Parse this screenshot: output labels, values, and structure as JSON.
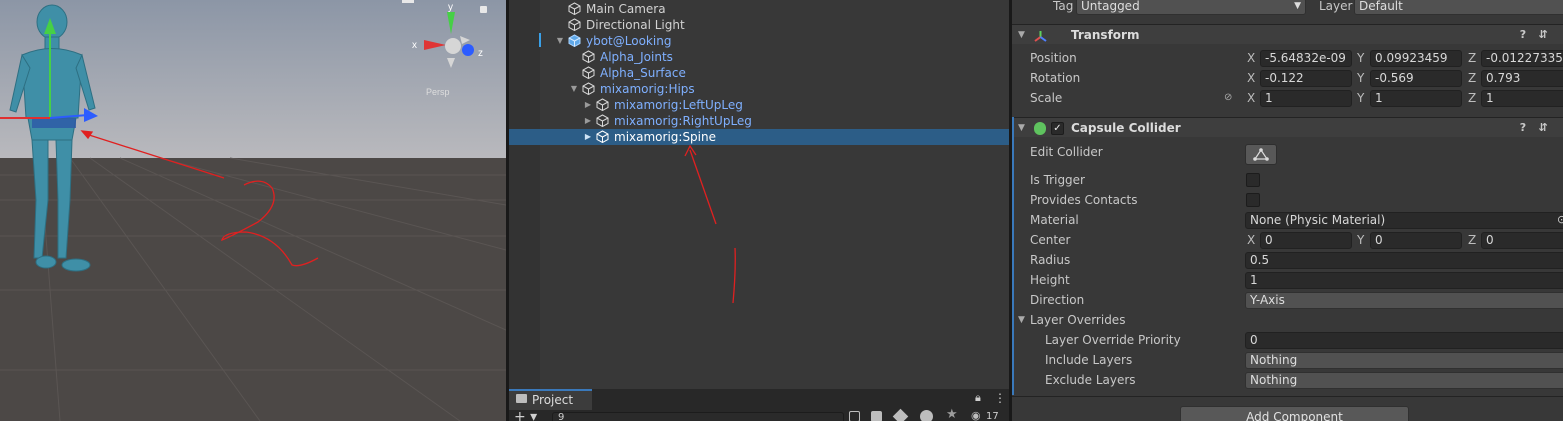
{
  "hierarchy": {
    "items": [
      {
        "label": "Main Camera",
        "style": "plain"
      },
      {
        "label": "Directional Light",
        "style": "plain"
      },
      {
        "label": "ybot@Looking",
        "style": "prefab"
      },
      {
        "label": "Alpha_Joints",
        "style": "prefab"
      },
      {
        "label": "Alpha_Surface",
        "style": "prefab"
      },
      {
        "label": "mixamorig:Hips",
        "style": "prefab"
      },
      {
        "label": "mixamorig:LeftUpLeg",
        "style": "prefab"
      },
      {
        "label": "mixamorig:RightUpLeg",
        "style": "prefab"
      },
      {
        "label": "mixamorig:Spine",
        "style": "selected"
      }
    ]
  },
  "project_panel": {
    "tab_label": "Project",
    "search_value": "9",
    "hidden_count": "17"
  },
  "scene": {
    "gizmo_axes": {
      "y": "y",
      "x": "x",
      "z": "z"
    },
    "persp_label": "Persp"
  },
  "inspector": {
    "tag_label": "Tag",
    "tag_value": "Untagged",
    "layer_label": "Layer",
    "layer_value": "Default",
    "transform": {
      "title": "Transform",
      "position_label": "Position",
      "rotation_label": "Rotation",
      "scale_label": "Scale",
      "position": {
        "x": "-5.64832e-09",
        "y": "0.09923459",
        "z": "-0.01227335"
      },
      "rotation": {
        "x": "-0.122",
        "y": "-0.569",
        "z": "0.793"
      },
      "scale": {
        "x": "1",
        "y": "1",
        "z": "1"
      }
    },
    "capsule": {
      "title": "Capsule Collider",
      "edit_collider_label": "Edit Collider",
      "is_trigger_label": "Is Trigger",
      "provides_contacts_label": "Provides Contacts",
      "material_label": "Material",
      "material_value": "None (Physic Material)",
      "center_label": "Center",
      "center": {
        "x": "0",
        "y": "0",
        "z": "0"
      },
      "radius_label": "Radius",
      "radius_value": "0.5",
      "height_label": "Height",
      "height_value": "1",
      "direction_label": "Direction",
      "direction_value": "Y-Axis",
      "layer_overrides_label": "Layer Overrides",
      "layer_override_priority_label": "Layer Override Priority",
      "layer_override_priority_value": "0",
      "include_layers_label": "Include Layers",
      "include_layers_value": "Nothing",
      "exclude_layers_label": "Exclude Layers",
      "exclude_layers_value": "Nothing"
    },
    "add_component_label": "Add Component",
    "axis_letters": {
      "x": "X",
      "y": "Y",
      "z": "Z"
    }
  },
  "colors": {
    "selection": "#2c5d87",
    "prefab_text": "#7fb0ff",
    "annotation": "#e02020"
  }
}
